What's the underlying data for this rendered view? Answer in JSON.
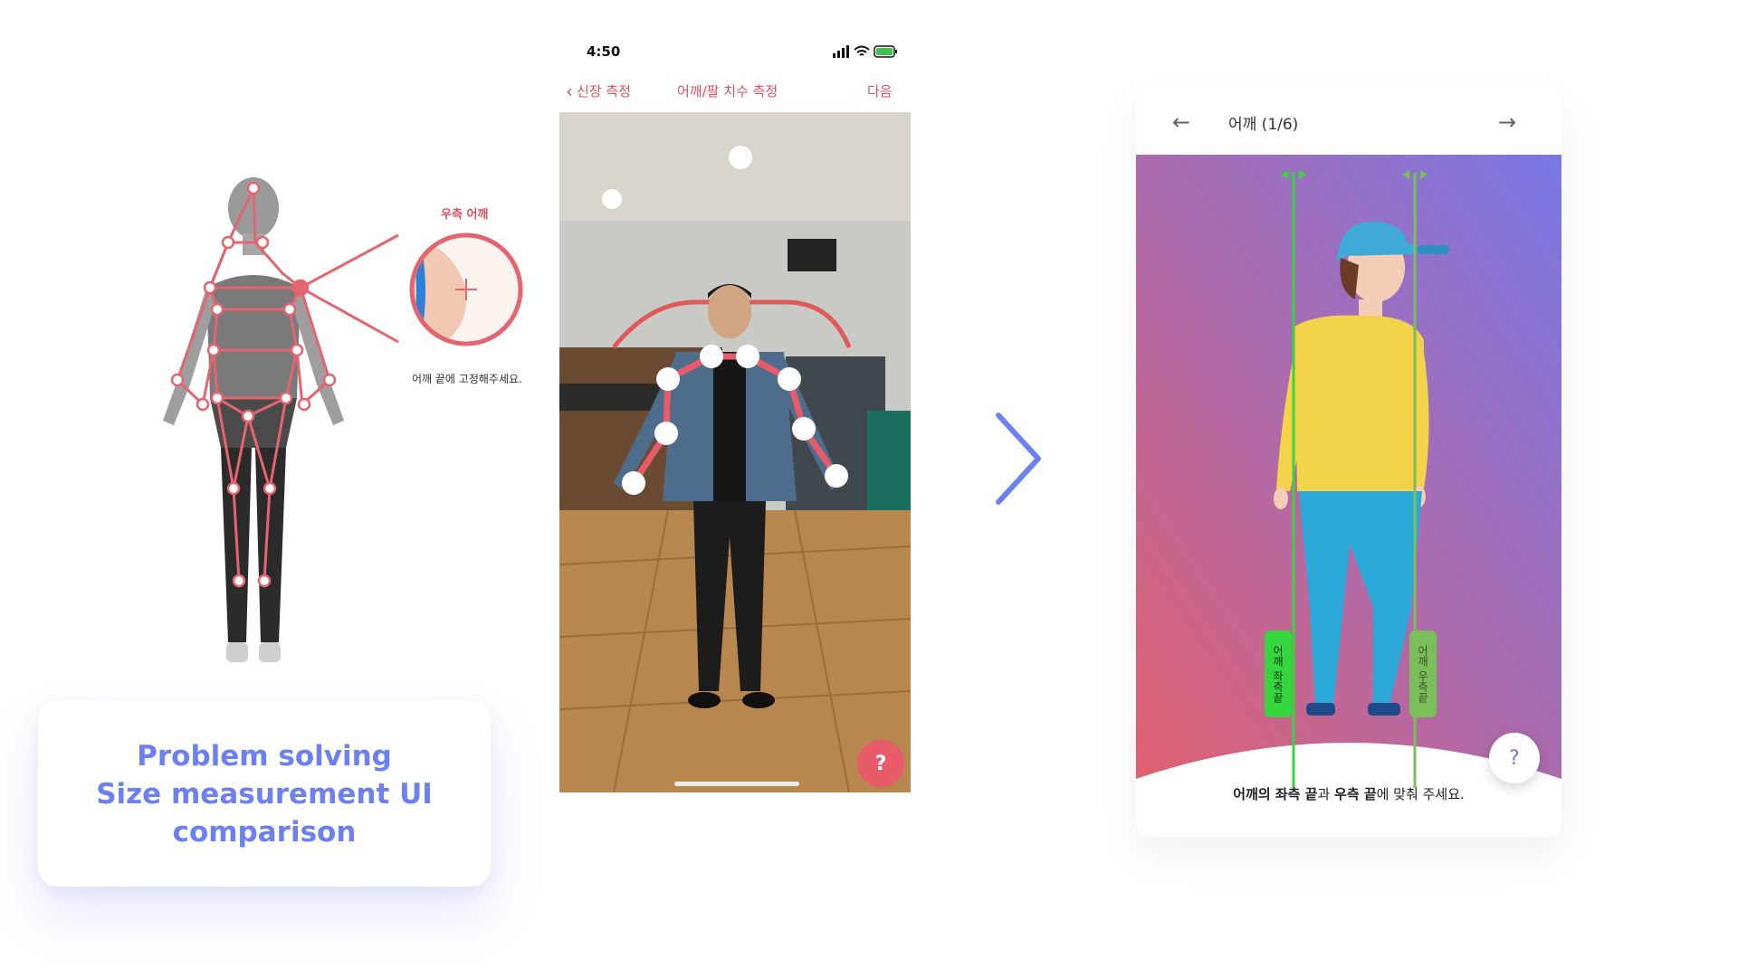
{
  "left_panel": {
    "zoom_label": "우측 어깨",
    "zoom_hint": "어깨 끝에 고정해주세요.",
    "caption_lines": [
      "Problem solving",
      "Size measurement UI",
      "comparison"
    ]
  },
  "phone": {
    "status_time": "4:50",
    "nav_back": "신장 측정",
    "nav_title": "어깨/팔 치수 측정",
    "nav_next": "다음",
    "help": "?"
  },
  "right_screen": {
    "title": "어깨 (1/6)",
    "instruction_parts": [
      "어깨의 좌측 끝",
      "과 ",
      "우측 끝",
      "에 맞춰 주세요."
    ],
    "tag_left": "어깨 좌측끝",
    "tag_right": "어깨 우측끝",
    "help": "?"
  },
  "colors": {
    "accent_red": "#e0505e",
    "accent_blue": "#6c80f2",
    "guide_green": "#35d63e"
  }
}
